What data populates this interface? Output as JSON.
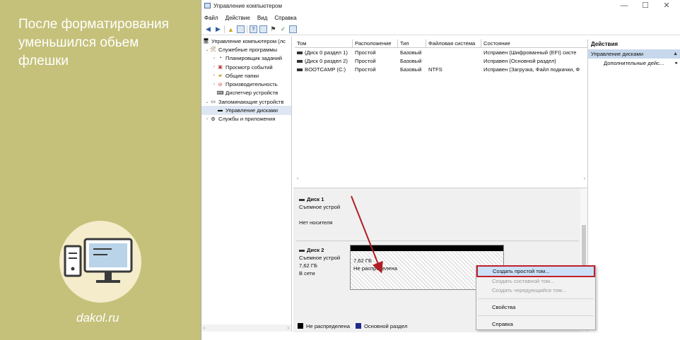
{
  "caption": {
    "lines": [
      "После форматирования",
      "уменьшился обьем",
      "флешки"
    ]
  },
  "brand": "dakol.ru",
  "window": {
    "title": "Управление компьютером",
    "controls": [
      "—",
      "☐",
      "✕"
    ]
  },
  "menu": [
    "Файл",
    "Действие",
    "Вид",
    "Справка"
  ],
  "tree": [
    {
      "label": "Управление компьютером (лс",
      "arrow": "",
      "indent": 0,
      "icon": "computer-icon"
    },
    {
      "label": "Служебные программы",
      "arrow": "⌄",
      "indent": 1,
      "icon": "tools-icon"
    },
    {
      "label": "Планировщик заданий",
      "arrow": "›",
      "indent": 2,
      "icon": "clock-icon"
    },
    {
      "label": "Просмотр событий",
      "arrow": "›",
      "indent": 2,
      "icon": "event-log-icon"
    },
    {
      "label": "Общие папки",
      "arrow": "›",
      "indent": 2,
      "icon": "folder-icon"
    },
    {
      "label": "Производительность",
      "arrow": "›",
      "indent": 2,
      "icon": "performance-icon"
    },
    {
      "label": "Диспетчер устройств",
      "arrow": "",
      "indent": 2,
      "icon": "device-manager-icon"
    },
    {
      "label": "Запоминающие устройств",
      "arrow": "⌄",
      "indent": 1,
      "icon": "storage-icon"
    },
    {
      "label": "Управление дисками",
      "arrow": "",
      "indent": 2,
      "icon": "disk-management-icon",
      "selected": true
    },
    {
      "label": "Службы и приложения",
      "arrow": "›",
      "indent": 1,
      "icon": "services-icon"
    }
  ],
  "table": {
    "headers": [
      "Том",
      "Расположение",
      "Тип",
      "Файловая система",
      "Состояние"
    ],
    "rows": [
      [
        "(Диск 0 раздел 1)",
        "Простой",
        "Базовый",
        "",
        "Исправен (Шифрованный (EFI) систе"
      ],
      [
        "(Диск 0 раздел 2)",
        "Простой",
        "Базовый",
        "",
        "Исправен (Основной раздел)"
      ],
      [
        "BOOTCAMP (C:)",
        "Простой",
        "Базовый",
        "NTFS",
        "Исправен (Загрузка, Файл подкачки, Ф"
      ]
    ]
  },
  "disks": [
    {
      "name": "Диск 1",
      "type": "Съемное устрой",
      "size": "",
      "status": "Нет носителя"
    },
    {
      "name": "Диск 2",
      "type": "Съемное устрой",
      "size": "7,62 ГБ",
      "status": "В сети"
    }
  ],
  "partition": {
    "size": "7,62 ГБ",
    "status": "Не распределена"
  },
  "legend": [
    "Не распределена",
    "Основной раздел"
  ],
  "context_menu": {
    "items": [
      {
        "label": "Создать простой том...",
        "disabled": false,
        "highlighted": true
      },
      {
        "label": "Создать составной том...",
        "disabled": true
      },
      {
        "label": "Создать чередующийся том...",
        "disabled": true
      },
      {
        "label": "Свойства",
        "disabled": false
      },
      {
        "label": "Справка",
        "disabled": false
      }
    ]
  },
  "actions": {
    "header": "Действия",
    "section": "Управление дисками",
    "item": "Дополнительные дейс..."
  },
  "colors": {
    "highlight_outline": "#c0202a",
    "selection": "#cce0f7",
    "legend_unallocated": "#000000",
    "legend_primary": "#1f2a8a"
  }
}
